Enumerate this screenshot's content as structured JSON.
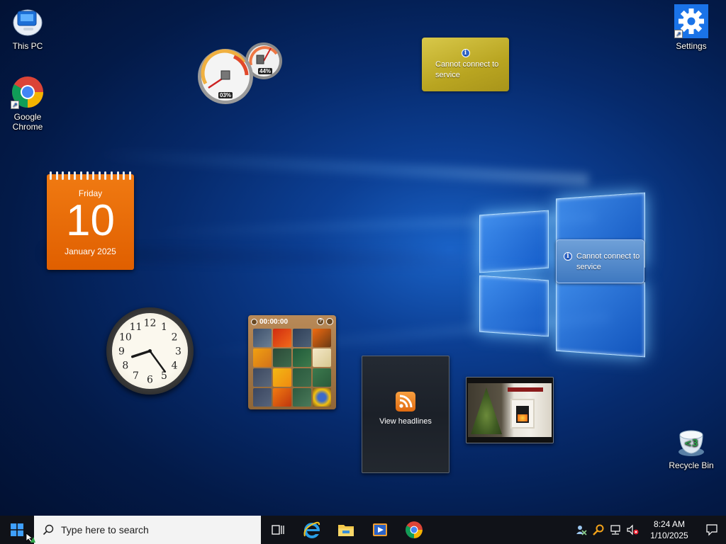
{
  "desktop": {
    "icons": [
      {
        "label": "This PC",
        "icon": "computer-icon"
      },
      {
        "label": "Google Chrome",
        "icon": "chrome-icon"
      },
      {
        "label": "Settings",
        "icon": "gear-icon"
      },
      {
        "label": "Recycle Bin",
        "icon": "recycle-bin-icon"
      }
    ]
  },
  "gadgets": {
    "cpu_meter": {
      "cpu": "03%",
      "memory": "44%"
    },
    "calendar": {
      "weekday": "Friday",
      "day": "10",
      "month_year": "January 2025"
    },
    "currency": {
      "message": "Cannot connect to service"
    },
    "weather": {
      "message": "Cannot connect to service"
    },
    "puzzle": {
      "timer": "00:00:00"
    },
    "feed": {
      "label": "View headlines"
    },
    "clock": {
      "numerals": [
        "12",
        "1",
        "2",
        "3",
        "4",
        "5",
        "6",
        "7",
        "8",
        "9",
        "10",
        "11"
      ],
      "hour": 8,
      "minute": 24
    }
  },
  "taskbar": {
    "search_placeholder": "Type here to search",
    "pinned": [
      "task-view-icon",
      "internet-explorer-icon",
      "file-explorer-icon",
      "media-player-icon",
      "chrome-icon"
    ],
    "time": "8:24 AM",
    "date": "1/10/2025"
  },
  "colors": {
    "accent": "#0078d7",
    "taskbar": "#101218",
    "calendar": "#e8690a"
  }
}
